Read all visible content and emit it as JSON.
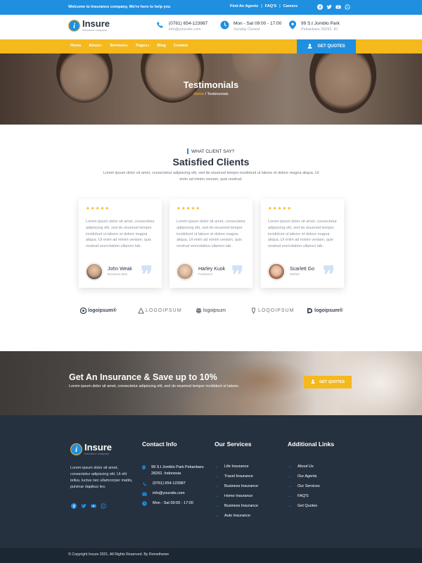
{
  "topbar": {
    "welcome": "Welcome to Insurance company, We're here to help you",
    "links": [
      "Find An Agents",
      "FAQ'S",
      "Careers"
    ],
    "social_icons": [
      "facebook-icon",
      "twitter-icon",
      "youtube-icon",
      "whatsapp-icon"
    ]
  },
  "brand": {
    "name": "Insure",
    "tagline": "Insurance company",
    "logo_letter": "i"
  },
  "header": {
    "phone": "(0761) 654-123987",
    "email": "info@yoursite.com",
    "hours": "Mon - Sat 09:00 - 17:00",
    "closed": "Sunday Closed",
    "address": "99 S.t Jomblo Park",
    "city": "Pekanbaru 28292. ID"
  },
  "nav": {
    "items": [
      "Home",
      "About",
      "Services",
      "Pages",
      "Blog",
      "Contact"
    ],
    "cta": "GET QUOTES"
  },
  "hero": {
    "title": "Testimonials",
    "crumb_home": "Home",
    "crumb_sep": "/",
    "crumb_current": "Testimonials"
  },
  "testimonials": {
    "eyebrow": "WHAT CLIENT SAY?",
    "title": "Satisfied Clients",
    "description": "Lorem ipsum dolor sit amet, consectetur adipiscing elit, sed do eiusmod tempor incididunt ut labore et dolore magna aliqua. Ut enim ad minim veniam, quis nostrud.",
    "stars": "★★★★★",
    "quote_mark": "❞",
    "cards": [
      {
        "text": "Lorem ipsum dolor sit amet, consectetur adipiscing elit, sed do eiusmod tempor incididunt ut labore et dolore magna aliqua. Ut enim ad minim veniam, quis nostrud exercitation ullamco lab.",
        "name": "John Weak",
        "role": "Business Man"
      },
      {
        "text": "Lorem ipsum dolor sit amet, consectetur adipiscing elit, sed do eiusmod tempor incididunt ut labore et dolore magna aliqua. Ut enim ad minim veniam, quis nostrud exercitation ullamco lab.",
        "name": "Harley Kuok",
        "role": "Freelance"
      },
      {
        "text": "Lorem ipsum dolor sit amet, consectetur adipiscing elit, sed do eiusmod tempor incididunt ut labore et dolore magna aliqua. Ut enim ad minim veniam, quis nostrud exercitation ullamco lab.",
        "name": "Scarlett Go",
        "role": "Mother"
      }
    ]
  },
  "partners": [
    "logoipsum®",
    "LOGOIPSUM",
    "logoipsum",
    "LOQOIPSUM",
    "logoipsum®"
  ],
  "cta": {
    "title": "Get An Insurance & Save up to 10%",
    "text": "Lorem ipsum dolor sit amet, consectetur adipiscing elit, sed do eiusmod tempor incididunt ut labore.",
    "button": "GET QUOTES"
  },
  "footer": {
    "about": "Lorem ipsum dolor sit amet, consectetur adipiscing elit. Ut elit tellus, luctus nec ullamcorper mattis, pulvinar dapibus leo.",
    "contact_title": "Contact Info",
    "contact": [
      "99 S.t Jomblo Park Pekanbaru 28292. Indonesia",
      "(0761) 654-123987",
      "info@yoursite.com",
      "Mon - Sat 09:00 - 17:00"
    ],
    "services_title": "Our Services",
    "services": [
      "Life Insurance",
      "Travel Insurance",
      "Business Insurance",
      "Home Insurance",
      "Business Insurance",
      "Auto Insurance"
    ],
    "links_title": "Additional Links",
    "links": [
      "About Us",
      "Our Agents",
      "Our Services",
      "FAQ'S",
      "Get Quotes"
    ],
    "copyright": "© Copyright Insure 2021. All Rights Reserved. By Rometheme"
  },
  "colors": {
    "primary": "#1f8fe0",
    "accent": "#f5b91e",
    "dark": "#263140",
    "text": "#2a3340"
  }
}
